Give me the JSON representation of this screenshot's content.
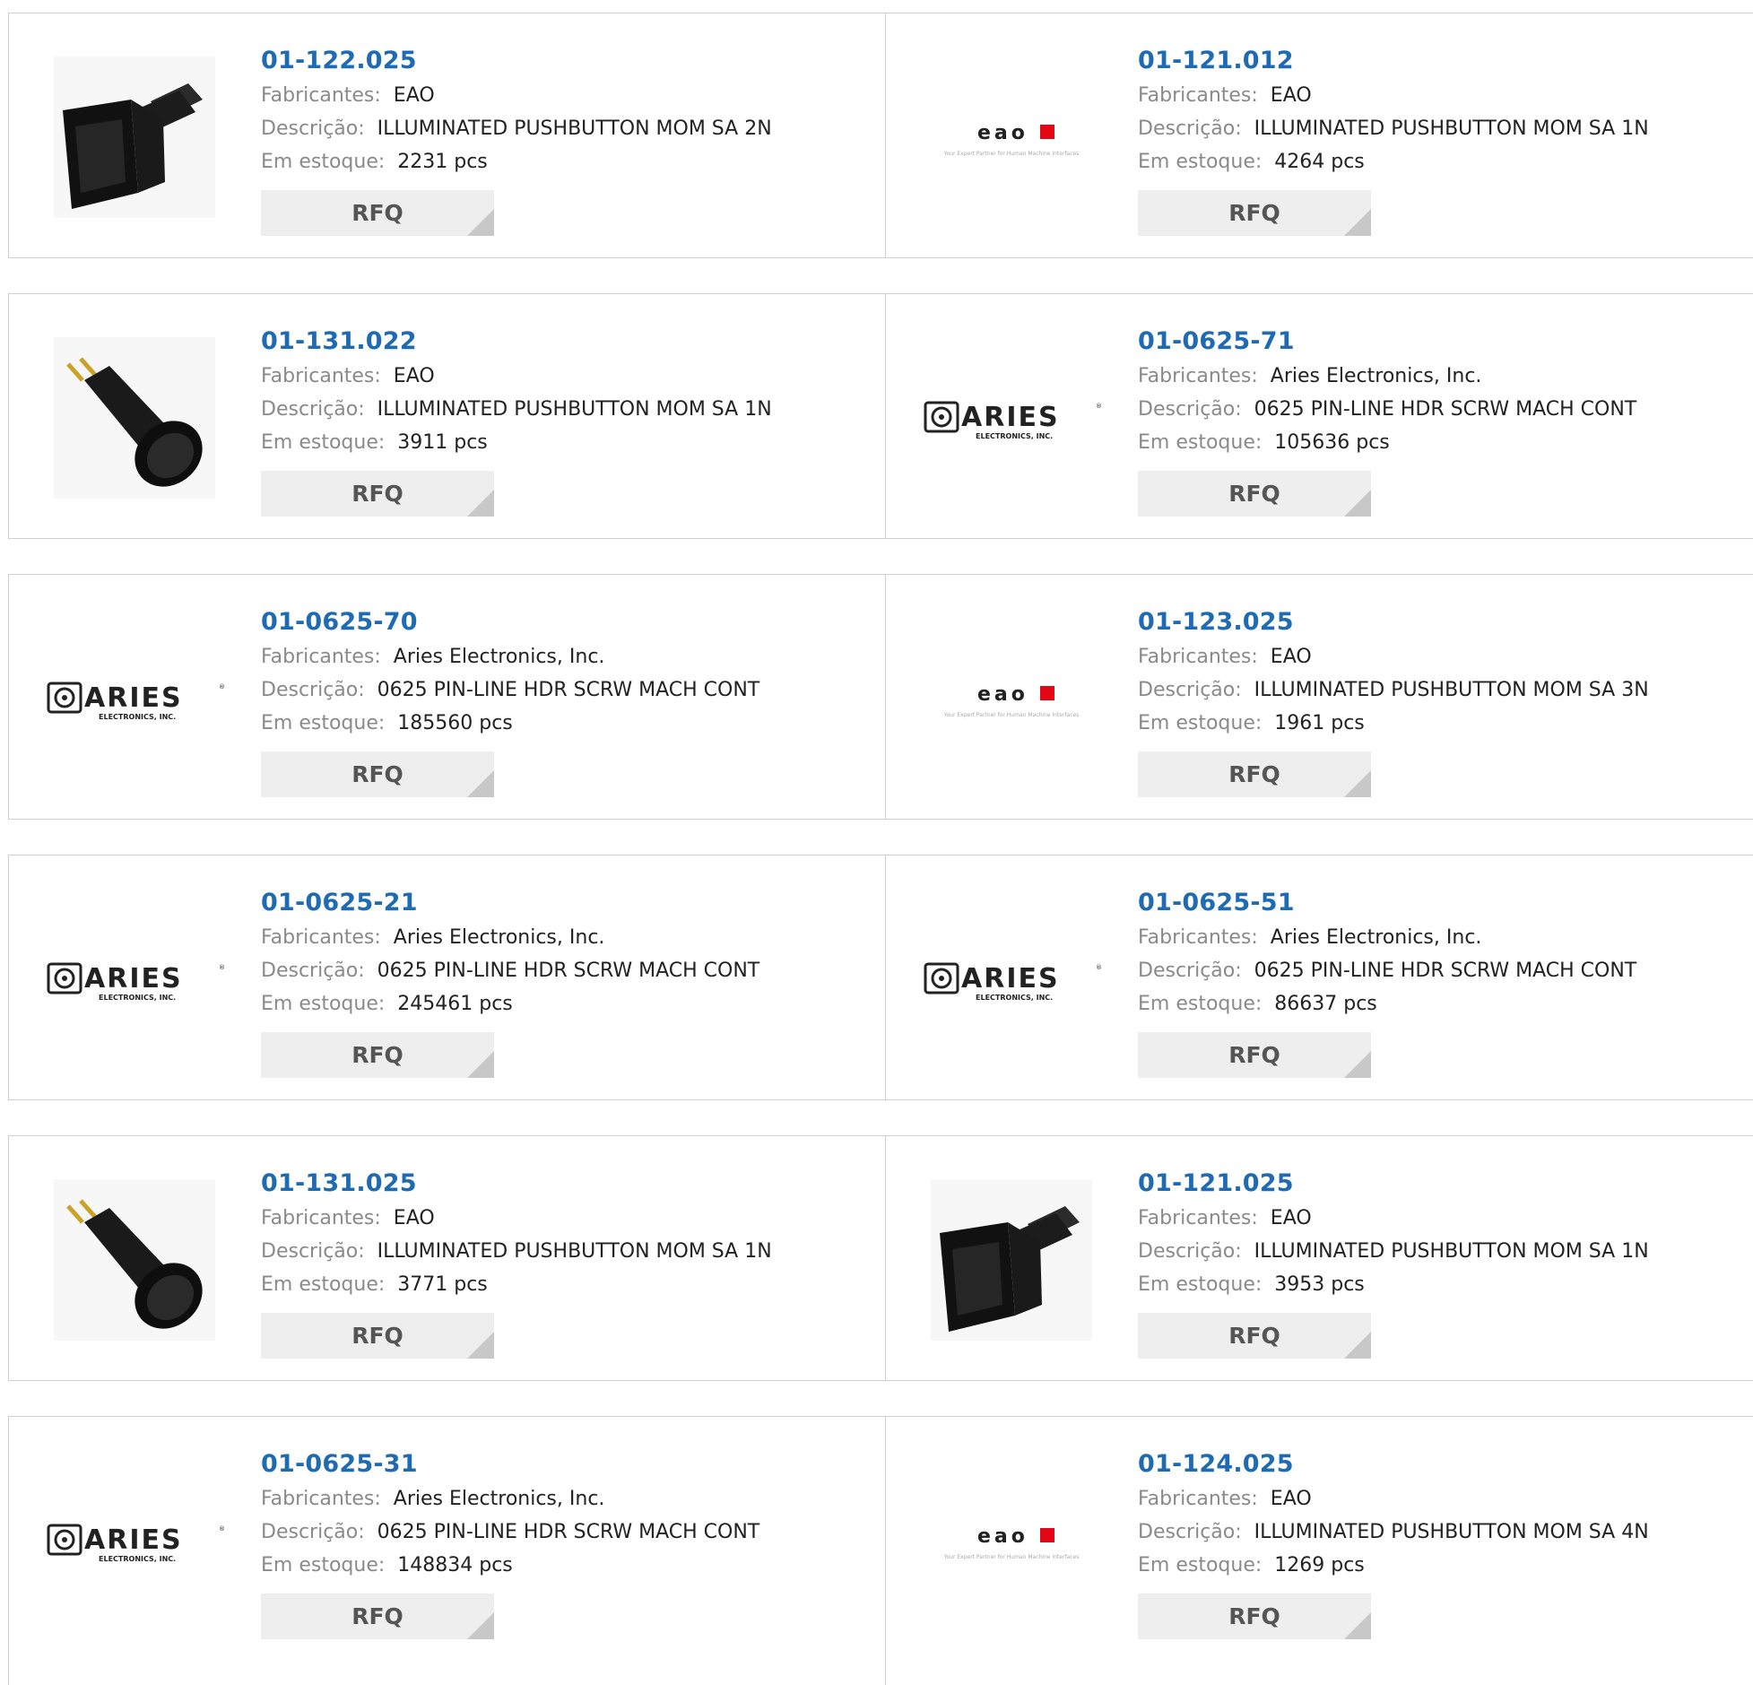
{
  "labels": {
    "manufacturer": "Fabricantes:",
    "description": "Descrição:",
    "stock": "Em estoque:",
    "rfq": "RFQ"
  },
  "colors": {
    "part_link": "#1f6bb3",
    "label_gray": "#8a8a8a",
    "button_bg": "#eeeeee",
    "eao_red": "#e30613"
  },
  "products": [
    {
      "part": "01-122.025",
      "manufacturer": "EAO",
      "description": "ILLUMINATED PUSHBUTTON MOM SA 2N",
      "stock": "2231 pcs",
      "image": "square-pushbutton-photo"
    },
    {
      "part": "01-121.012",
      "manufacturer": "EAO",
      "description": "ILLUMINATED PUSHBUTTON MOM SA 1N",
      "stock": "4264 pcs",
      "image": "eao-logo"
    },
    {
      "part": "01-131.022",
      "manufacturer": "EAO",
      "description": "ILLUMINATED PUSHBUTTON MOM SA 1N",
      "stock": "3911 pcs",
      "image": "round-pushbutton-photo"
    },
    {
      "part": "01-0625-71",
      "manufacturer": "Aries Electronics, Inc.",
      "description": "0625 PIN-LINE HDR SCRW MACH CONT",
      "stock": "105636 pcs",
      "image": "aries-logo"
    },
    {
      "part": "01-0625-70",
      "manufacturer": "Aries Electronics, Inc.",
      "description": "0625 PIN-LINE HDR SCRW MACH CONT",
      "stock": "185560 pcs",
      "image": "aries-logo"
    },
    {
      "part": "01-123.025",
      "manufacturer": "EAO",
      "description": "ILLUMINATED PUSHBUTTON MOM SA 3N",
      "stock": "1961 pcs",
      "image": "eao-logo"
    },
    {
      "part": "01-0625-21",
      "manufacturer": "Aries Electronics, Inc.",
      "description": "0625 PIN-LINE HDR SCRW MACH CONT",
      "stock": "245461 pcs",
      "image": "aries-logo"
    },
    {
      "part": "01-0625-51",
      "manufacturer": "Aries Electronics, Inc.",
      "description": "0625 PIN-LINE HDR SCRW MACH CONT",
      "stock": "86637 pcs",
      "image": "aries-logo"
    },
    {
      "part": "01-131.025",
      "manufacturer": "EAO",
      "description": "ILLUMINATED PUSHBUTTON MOM SA 1N",
      "stock": "3771 pcs",
      "image": "round-pushbutton-photo"
    },
    {
      "part": "01-121.025",
      "manufacturer": "EAO",
      "description": "ILLUMINATED PUSHBUTTON MOM SA 1N",
      "stock": "3953 pcs",
      "image": "square-pushbutton-photo"
    },
    {
      "part": "01-0625-31",
      "manufacturer": "Aries Electronics, Inc.",
      "description": "0625 PIN-LINE HDR SCRW MACH CONT",
      "stock": "148834 pcs",
      "image": "aries-logo"
    },
    {
      "part": "01-124.025",
      "manufacturer": "EAO",
      "description": "ILLUMINATED PUSHBUTTON MOM SA 4N",
      "stock": "1269 pcs",
      "image": "eao-logo"
    }
  ]
}
